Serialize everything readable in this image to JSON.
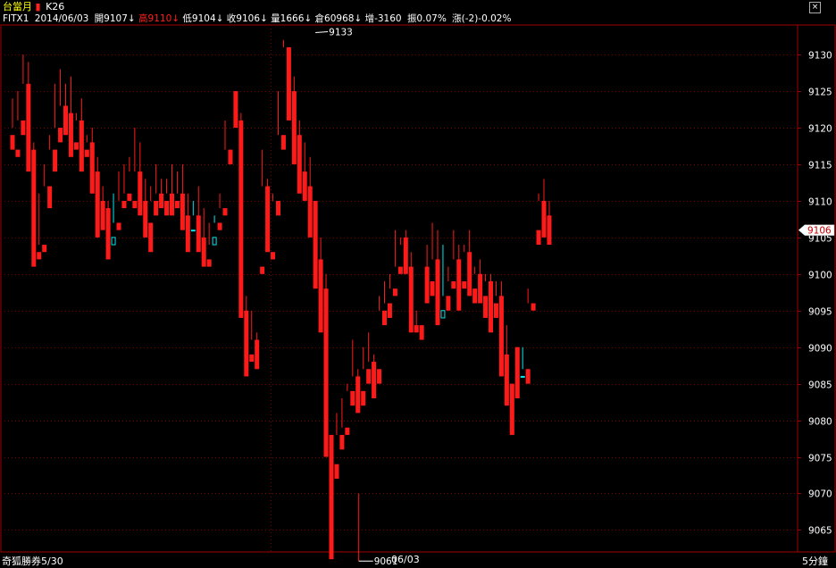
{
  "header": {
    "product": "台當月",
    "indicator": "K26",
    "symbol": "FITX1",
    "date": "2014/06/03",
    "open": "開9107↓",
    "high": "高9110↓",
    "low": "低9104↓",
    "close": "收9106↓",
    "volume": "量1666↓",
    "open_interest": "倉60968↓",
    "oi_change": "增-3160",
    "amplitude": "振0.07%",
    "change": "漲(-2)-0.02%"
  },
  "close_button": "×",
  "footer": {
    "left": "奇狐勝券5/30",
    "middle": "06/03",
    "right": "5分鐘"
  },
  "colors": {
    "up": "#00e8f0",
    "down": "#ff1a1a",
    "grid": "#7a0000",
    "axis": "#a00000",
    "text": "#ffffff",
    "last_price_box": "#ffffff",
    "last_price_text": "#cc0000"
  },
  "chart_data": {
    "type": "candlestick",
    "y_ticks": [
      9065,
      9070,
      9075,
      9080,
      9085,
      9090,
      9095,
      9100,
      9105,
      9110,
      9115,
      9120,
      9125,
      9130
    ],
    "ylim": [
      9062,
      9133.8
    ],
    "last_price": 9106,
    "max_annotation": {
      "index": 57,
      "value": 9133,
      "label": "9133"
    },
    "min_annotation": {
      "index": 66,
      "value": 9061,
      "label": "9061"
    },
    "session_break_index": 49,
    "candles": [
      [
        9119,
        9124,
        9120,
        9117
      ],
      [
        9117,
        9125,
        9121,
        9116
      ],
      [
        9121,
        9130,
        9126,
        9119
      ],
      [
        9126,
        9129,
        9117,
        9114
      ],
      [
        9117,
        9118,
        9103,
        9101
      ],
      [
        9103,
        9111,
        9104,
        9102
      ],
      [
        9104,
        9115,
        9112,
        9103
      ],
      [
        9112,
        9119,
        9117,
        9109
      ],
      [
        9117,
        9126,
        9120,
        9114
      ],
      [
        9120,
        9128,
        9123,
        9118
      ],
      [
        9123,
        9126,
        9122,
        9119
      ],
      [
        9122,
        9127,
        9118,
        9116
      ],
      [
        9118,
        9122,
        9121,
        9117
      ],
      [
        9121,
        9124,
        9117,
        9114
      ],
      [
        9117,
        9119,
        9118,
        9116
      ],
      [
        9118,
        9120,
        9114,
        9111
      ],
      [
        9114,
        9116,
        9110,
        9105
      ],
      [
        9110,
        9112,
        9109,
        9106
      ],
      [
        9109,
        9110,
        9104,
        9102
      ],
      [
        9104,
        9111,
        9107,
        9105
      ],
      [
        9107,
        9114,
        9110,
        9106
      ],
      [
        9110,
        9115,
        9111,
        9109
      ],
      [
        9111,
        9116,
        9114,
        9110
      ],
      [
        9110,
        9120,
        9114,
        9109
      ],
      [
        9114,
        9118,
        9110,
        9108
      ],
      [
        9110,
        9113,
        9107,
        9105
      ],
      [
        9107,
        9112,
        9110,
        9103
      ],
      [
        9110,
        9115,
        9111,
        9108
      ],
      [
        9111,
        9113,
        9110,
        9109
      ],
      [
        9110,
        9113,
        9111,
        9108
      ],
      [
        9111,
        9115,
        9110,
        9108
      ],
      [
        9110,
        9114,
        9111,
        9109
      ],
      [
        9111,
        9115,
        9108,
        9106
      ],
      [
        9108,
        9111,
        9106,
        9103
      ],
      [
        9106,
        9110,
        9108,
        9106
      ],
      [
        9108,
        9112,
        9105,
        9103
      ],
      [
        9105,
        9109,
        9102,
        9101
      ],
      [
        9102,
        9107,
        9104,
        9101
      ],
      [
        9104,
        9108,
        9107,
        9105
      ],
      [
        9107,
        9111,
        9109,
        9106
      ],
      [
        9109,
        9121,
        9117,
        9108
      ],
      [
        9117,
        9125,
        9125,
        9115
      ],
      [
        9125,
        9125,
        9121,
        9120
      ],
      [
        9121,
        9122,
        9095,
        9094
      ],
      [
        9095,
        9097,
        9091,
        9086
      ],
      [
        9089,
        9095,
        9091,
        9088
      ],
      [
        9091,
        9092,
        9089,
        9087
      ],
      [
        9101,
        9117,
        9112,
        9100
      ],
      [
        9112,
        9113,
        9108,
        9103
      ],
      [
        9103,
        9111,
        9110,
        9102
      ],
      [
        9110,
        9125,
        9119,
        9108
      ],
      [
        9119,
        9132,
        9131,
        9117
      ],
      [
        9131,
        9131,
        9125,
        9121
      ],
      [
        9125,
        9127,
        9119,
        9115
      ],
      [
        9119,
        9121,
        9114,
        9111
      ],
      [
        9114,
        9118,
        9112,
        9110
      ],
      [
        9112,
        9116,
        9110,
        9105
      ],
      [
        9110,
        9108,
        9102,
        9098
      ],
      [
        9102,
        9105,
        9098,
        9092
      ],
      [
        9098,
        9100,
        9078,
        9075
      ],
      [
        9078,
        9078,
        9070,
        9061
      ],
      [
        9074,
        9081,
        9078,
        9072
      ],
      [
        9078,
        9083,
        9079,
        9076
      ],
      [
        9079,
        9085,
        9084,
        9078
      ],
      [
        9084,
        9091,
        9086,
        9082
      ],
      [
        9086,
        9087,
        9084,
        9081
      ],
      [
        9084,
        9090,
        9087,
        9082
      ],
      [
        9087,
        9092,
        9088,
        9085
      ],
      [
        9088,
        9089,
        9087,
        9083
      ],
      [
        9087,
        9097,
        9095,
        9085
      ],
      [
        9095,
        9099,
        9096,
        9093
      ],
      [
        9096,
        9100,
        9098,
        9094
      ],
      [
        9098,
        9106,
        9101,
        9097
      ],
      [
        9101,
        9104,
        9105,
        9100
      ],
      [
        9105,
        9106,
        9101,
        9100
      ],
      [
        9101,
        9103,
        9093,
        9092
      ],
      [
        9093,
        9095,
        9093,
        9092
      ],
      [
        9093,
        9101,
        9101,
        9091
      ],
      [
        9101,
        9104,
        9099,
        9096
      ],
      [
        9099,
        9107,
        9102,
        9097
      ],
      [
        9102,
        9106,
        9094,
        9093
      ],
      [
        9094,
        9104,
        9097,
        9095
      ],
      [
        9097,
        9101,
        9099,
        9095
      ],
      [
        9099,
        9106,
        9102,
        9098
      ],
      [
        9102,
        9104,
        9099,
        9095
      ],
      [
        9099,
        9104,
        9103,
        9098
      ],
      [
        9103,
        9106,
        9098,
        9097
      ],
      [
        9098,
        9101,
        9100,
        9096
      ],
      [
        9100,
        9102,
        9097,
        9096
      ],
      [
        9097,
        9100,
        9099,
        9094
      ],
      [
        9099,
        9100,
        9096,
        9092
      ],
      [
        9096,
        9099,
        9097,
        9094
      ],
      [
        9097,
        9099,
        9089,
        9086
      ],
      [
        9089,
        9093,
        9085,
        9082
      ],
      [
        9085,
        9090,
        9090,
        9078
      ],
      [
        9090,
        9090,
        9086,
        9083
      ],
      [
        9086,
        9090,
        9087,
        9086
      ],
      [
        9087,
        9098,
        9096,
        9085
      ],
      [
        9096,
        9106,
        9106,
        9095
      ],
      [
        9106,
        9111,
        9110,
        9104
      ],
      [
        9110,
        9113,
        9108,
        9105
      ],
      [
        9108,
        9110,
        9106,
        9104
      ]
    ]
  }
}
